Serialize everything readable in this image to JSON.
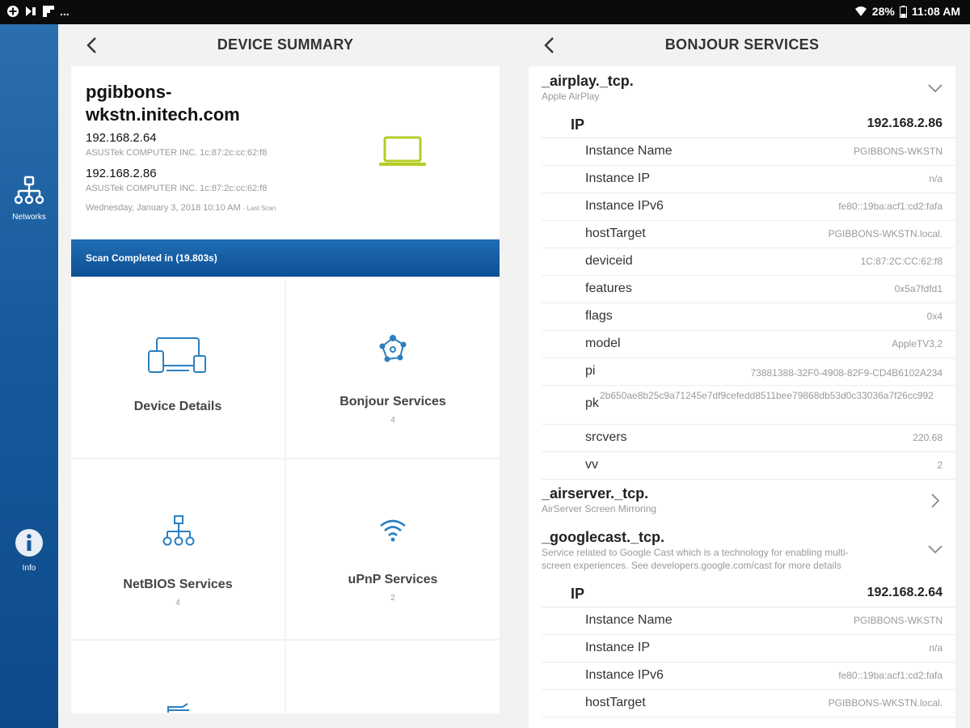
{
  "status_bar": {
    "battery": "28%",
    "time": "11:08 AM",
    "more": "..."
  },
  "rail": {
    "items": [
      {
        "label": "Networks",
        "icon": "network-icon"
      },
      {
        "label": "Info",
        "icon": "info-icon"
      }
    ]
  },
  "device_summary": {
    "title": "DEVICE SUMMARY",
    "hostname_line1": "pgibbons-",
    "hostname_line2": "wkstn.initech.com",
    "addresses": [
      {
        "ip": "192.168.2.64",
        "vendor": "ASUSTek COMPUTER INC. 1c:87:2c:cc:62:f8"
      },
      {
        "ip": "192.168.2.86",
        "vendor": "ASUSTek COMPUTER INC. 1c:87:2c:cc:62:f8"
      }
    ],
    "scan_date": "Wednesday, January 3, 2018 10:10 AM",
    "scan_date_suffix": "- Last Scan",
    "scan_status": "Scan Completed in (19.803s)",
    "tiles": [
      {
        "label": "Device Details",
        "count": ""
      },
      {
        "label": "Bonjour Services",
        "count": "4"
      },
      {
        "label": "NetBIOS Services",
        "count": "4"
      },
      {
        "label": "uPnP Services",
        "count": "2"
      }
    ],
    "accent_color": "#b5cc27"
  },
  "bonjour": {
    "title": "BONJOUR SERVICES",
    "services": [
      {
        "name": "_airplay._tcp.",
        "desc": "Apple AirPlay",
        "ip_label": "IP",
        "ip": "192.168.2.86",
        "fields": [
          {
            "k": "Instance Name",
            "v": "PGIBBONS-WKSTN"
          },
          {
            "k": "Instance IP",
            "v": "n/a"
          },
          {
            "k": "Instance IPv6",
            "v": "fe80::19ba:acf1:cd2:fafa"
          },
          {
            "k": "hostTarget",
            "v": "PGIBBONS-WKSTN.local."
          },
          {
            "k": "deviceid",
            "v": "1C:87:2C:CC:62:f8"
          },
          {
            "k": "features",
            "v": "0x5a7fdfd1"
          },
          {
            "k": "flags",
            "v": "0x4"
          },
          {
            "k": "model",
            "v": "AppleTV3,2"
          },
          {
            "k": "pi",
            "v": "73881388-32F0-4908-82F9-CD4B6102A234"
          },
          {
            "k": "pk",
            "v": "2b650ae8b25c9a71245e7df9cefedd8511bee79868db53d0c33036a7f26cc992"
          },
          {
            "k": "srcvers",
            "v": "220.68"
          },
          {
            "k": "vv",
            "v": "2"
          }
        ]
      },
      {
        "name": "_airserver._tcp.",
        "desc": "AirServer Screen Mirroring"
      },
      {
        "name": "_googlecast._tcp.",
        "desc_line1": "Service related to Google Cast which is a technology for enabling multi-",
        "desc_line2": "screen experiences. See developers.google.com/cast for more details",
        "ip_label": "IP",
        "ip": "192.168.2.64",
        "fields": [
          {
            "k": "Instance Name",
            "v": "PGIBBONS-WKSTN"
          },
          {
            "k": "Instance IP",
            "v": "n/a"
          },
          {
            "k": "Instance IPv6",
            "v": "fe80::19ba:acf1:cd2:fafa"
          },
          {
            "k": "hostTarget",
            "v": "PGIBBONS-WKSTN.local."
          }
        ]
      }
    ]
  }
}
